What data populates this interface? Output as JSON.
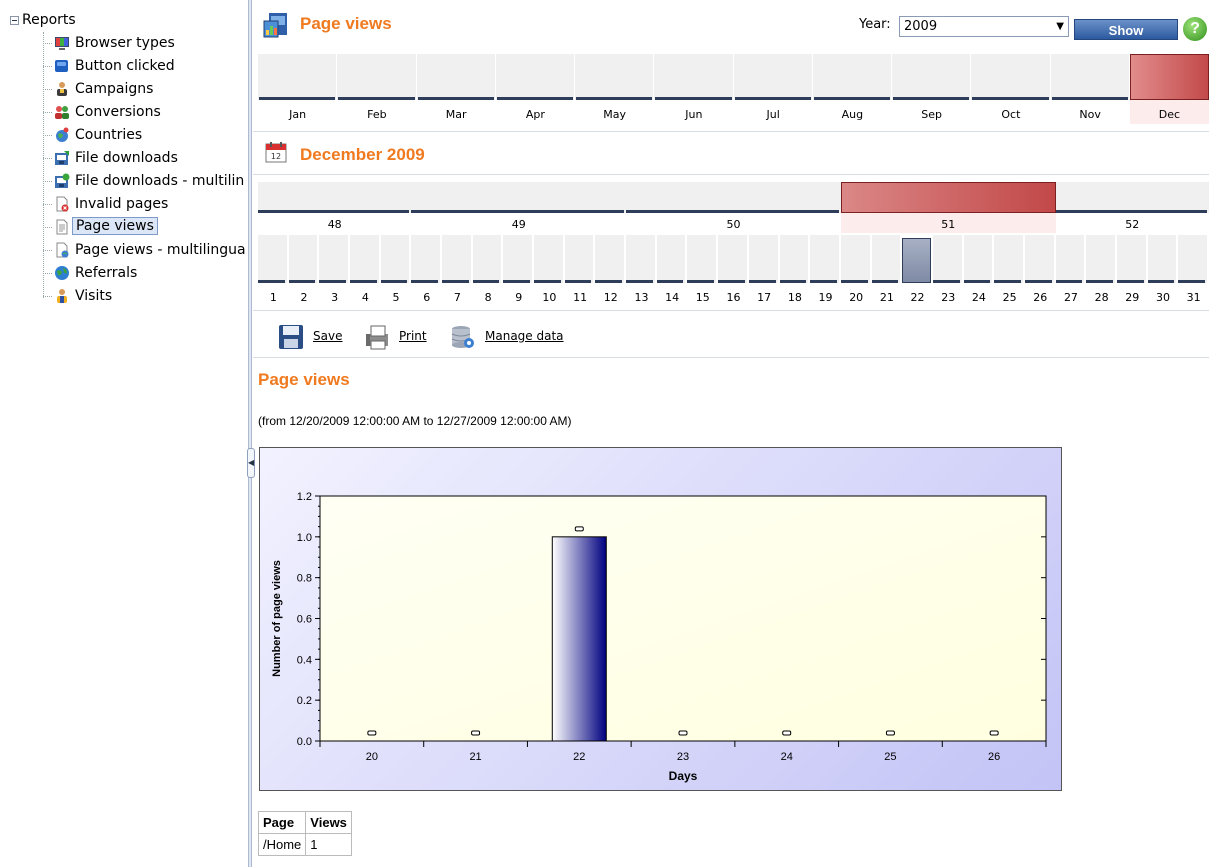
{
  "sidebar": {
    "root_label": "Reports",
    "items": [
      {
        "label": "Browser types",
        "icon": "browser-types-icon"
      },
      {
        "label": "Button clicked",
        "icon": "button-clicked-icon"
      },
      {
        "label": "Campaigns",
        "icon": "campaigns-icon"
      },
      {
        "label": "Conversions",
        "icon": "conversions-icon"
      },
      {
        "label": "Countries",
        "icon": "countries-icon"
      },
      {
        "label": "File downloads",
        "icon": "file-downloads-icon"
      },
      {
        "label": "File downloads - multilin",
        "icon": "file-downloads-multilingual-icon"
      },
      {
        "label": "Invalid pages",
        "icon": "invalid-pages-icon"
      },
      {
        "label": "Page views",
        "icon": "page-views-icon",
        "selected": true
      },
      {
        "label": "Page views - multilingua",
        "icon": "page-views-multilingual-icon"
      },
      {
        "label": "Referrals",
        "icon": "referrals-icon"
      },
      {
        "label": "Visits",
        "icon": "visits-icon"
      }
    ]
  },
  "header": {
    "title": "Page views",
    "year_label": "Year:",
    "year_value": "2009",
    "show_label": "Show",
    "help_glyph": "?"
  },
  "months": {
    "labels": [
      "Jan",
      "Feb",
      "Mar",
      "Apr",
      "May",
      "Jun",
      "Jul",
      "Aug",
      "Sep",
      "Oct",
      "Nov",
      "Dec"
    ],
    "selected": "Dec"
  },
  "month_view": {
    "title": "December 2009",
    "weeks": [
      "48",
      "49",
      "50",
      "51",
      "52"
    ],
    "selected_week": "51",
    "days": [
      "1",
      "2",
      "3",
      "4",
      "5",
      "6",
      "7",
      "8",
      "9",
      "10",
      "11",
      "12",
      "13",
      "14",
      "15",
      "16",
      "17",
      "18",
      "19",
      "20",
      "21",
      "22",
      "23",
      "24",
      "25",
      "26",
      "27",
      "28",
      "29",
      "30",
      "31"
    ],
    "selected_day": "22"
  },
  "toolbar": {
    "save_label": "Save",
    "print_label": "Print",
    "manage_label": "Manage data"
  },
  "report": {
    "title": "Page views",
    "range": "(from 12/20/2009 12:00:00 AM to 12/27/2009 12:00:00 AM)"
  },
  "chart_data": {
    "type": "bar",
    "categories": [
      "20",
      "21",
      "22",
      "23",
      "24",
      "25",
      "26"
    ],
    "values": [
      0,
      0,
      1,
      0,
      0,
      0,
      0
    ],
    "xlabel": "Days",
    "ylabel": "Number of page views",
    "ylim": [
      0,
      1.2
    ],
    "yticks": [
      "0.0",
      "0.2",
      "0.4",
      "0.6",
      "0.8",
      "1.0",
      "1.2"
    ],
    "data_labels": [
      "0",
      "0",
      "1",
      "0",
      "0",
      "0",
      "0"
    ],
    "colors": {
      "bar_dark": "#000080",
      "bar_light": "#ffffff",
      "plot_bg": "#ffffe0"
    }
  },
  "table": {
    "headers": [
      "Page",
      "Views"
    ],
    "rows": [
      [
        "/Home",
        "1"
      ]
    ]
  }
}
